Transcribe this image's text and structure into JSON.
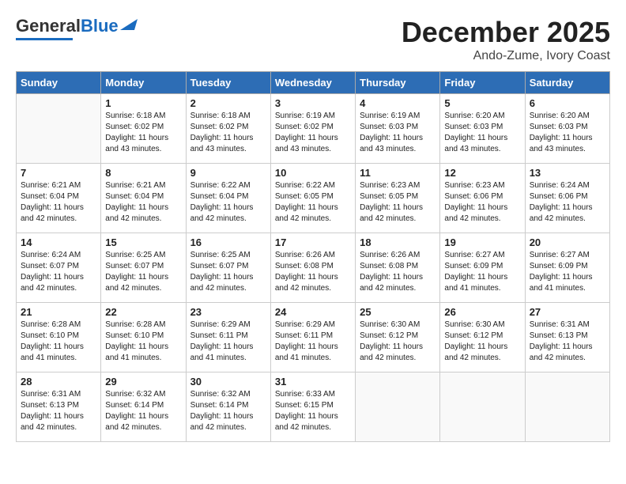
{
  "logo": {
    "text_general": "General",
    "text_blue": "Blue"
  },
  "title": "December 2025",
  "subtitle": "Ando-Zume, Ivory Coast",
  "days_of_week": [
    "Sunday",
    "Monday",
    "Tuesday",
    "Wednesday",
    "Thursday",
    "Friday",
    "Saturday"
  ],
  "weeks": [
    [
      {
        "day": "",
        "info": ""
      },
      {
        "day": "1",
        "info": "Sunrise: 6:18 AM\nSunset: 6:02 PM\nDaylight: 11 hours\nand 43 minutes."
      },
      {
        "day": "2",
        "info": "Sunrise: 6:18 AM\nSunset: 6:02 PM\nDaylight: 11 hours\nand 43 minutes."
      },
      {
        "day": "3",
        "info": "Sunrise: 6:19 AM\nSunset: 6:02 PM\nDaylight: 11 hours\nand 43 minutes."
      },
      {
        "day": "4",
        "info": "Sunrise: 6:19 AM\nSunset: 6:03 PM\nDaylight: 11 hours\nand 43 minutes."
      },
      {
        "day": "5",
        "info": "Sunrise: 6:20 AM\nSunset: 6:03 PM\nDaylight: 11 hours\nand 43 minutes."
      },
      {
        "day": "6",
        "info": "Sunrise: 6:20 AM\nSunset: 6:03 PM\nDaylight: 11 hours\nand 43 minutes."
      }
    ],
    [
      {
        "day": "7",
        "info": "Sunrise: 6:21 AM\nSunset: 6:04 PM\nDaylight: 11 hours\nand 42 minutes."
      },
      {
        "day": "8",
        "info": "Sunrise: 6:21 AM\nSunset: 6:04 PM\nDaylight: 11 hours\nand 42 minutes."
      },
      {
        "day": "9",
        "info": "Sunrise: 6:22 AM\nSunset: 6:04 PM\nDaylight: 11 hours\nand 42 minutes."
      },
      {
        "day": "10",
        "info": "Sunrise: 6:22 AM\nSunset: 6:05 PM\nDaylight: 11 hours\nand 42 minutes."
      },
      {
        "day": "11",
        "info": "Sunrise: 6:23 AM\nSunset: 6:05 PM\nDaylight: 11 hours\nand 42 minutes."
      },
      {
        "day": "12",
        "info": "Sunrise: 6:23 AM\nSunset: 6:06 PM\nDaylight: 11 hours\nand 42 minutes."
      },
      {
        "day": "13",
        "info": "Sunrise: 6:24 AM\nSunset: 6:06 PM\nDaylight: 11 hours\nand 42 minutes."
      }
    ],
    [
      {
        "day": "14",
        "info": "Sunrise: 6:24 AM\nSunset: 6:07 PM\nDaylight: 11 hours\nand 42 minutes."
      },
      {
        "day": "15",
        "info": "Sunrise: 6:25 AM\nSunset: 6:07 PM\nDaylight: 11 hours\nand 42 minutes."
      },
      {
        "day": "16",
        "info": "Sunrise: 6:25 AM\nSunset: 6:07 PM\nDaylight: 11 hours\nand 42 minutes."
      },
      {
        "day": "17",
        "info": "Sunrise: 6:26 AM\nSunset: 6:08 PM\nDaylight: 11 hours\nand 42 minutes."
      },
      {
        "day": "18",
        "info": "Sunrise: 6:26 AM\nSunset: 6:08 PM\nDaylight: 11 hours\nand 42 minutes."
      },
      {
        "day": "19",
        "info": "Sunrise: 6:27 AM\nSunset: 6:09 PM\nDaylight: 11 hours\nand 41 minutes."
      },
      {
        "day": "20",
        "info": "Sunrise: 6:27 AM\nSunset: 6:09 PM\nDaylight: 11 hours\nand 41 minutes."
      }
    ],
    [
      {
        "day": "21",
        "info": "Sunrise: 6:28 AM\nSunset: 6:10 PM\nDaylight: 11 hours\nand 41 minutes."
      },
      {
        "day": "22",
        "info": "Sunrise: 6:28 AM\nSunset: 6:10 PM\nDaylight: 11 hours\nand 41 minutes."
      },
      {
        "day": "23",
        "info": "Sunrise: 6:29 AM\nSunset: 6:11 PM\nDaylight: 11 hours\nand 41 minutes."
      },
      {
        "day": "24",
        "info": "Sunrise: 6:29 AM\nSunset: 6:11 PM\nDaylight: 11 hours\nand 41 minutes."
      },
      {
        "day": "25",
        "info": "Sunrise: 6:30 AM\nSunset: 6:12 PM\nDaylight: 11 hours\nand 42 minutes."
      },
      {
        "day": "26",
        "info": "Sunrise: 6:30 AM\nSunset: 6:12 PM\nDaylight: 11 hours\nand 42 minutes."
      },
      {
        "day": "27",
        "info": "Sunrise: 6:31 AM\nSunset: 6:13 PM\nDaylight: 11 hours\nand 42 minutes."
      }
    ],
    [
      {
        "day": "28",
        "info": "Sunrise: 6:31 AM\nSunset: 6:13 PM\nDaylight: 11 hours\nand 42 minutes."
      },
      {
        "day": "29",
        "info": "Sunrise: 6:32 AM\nSunset: 6:14 PM\nDaylight: 11 hours\nand 42 minutes."
      },
      {
        "day": "30",
        "info": "Sunrise: 6:32 AM\nSunset: 6:14 PM\nDaylight: 11 hours\nand 42 minutes."
      },
      {
        "day": "31",
        "info": "Sunrise: 6:33 AM\nSunset: 6:15 PM\nDaylight: 11 hours\nand 42 minutes."
      },
      {
        "day": "",
        "info": ""
      },
      {
        "day": "",
        "info": ""
      },
      {
        "day": "",
        "info": ""
      }
    ]
  ]
}
